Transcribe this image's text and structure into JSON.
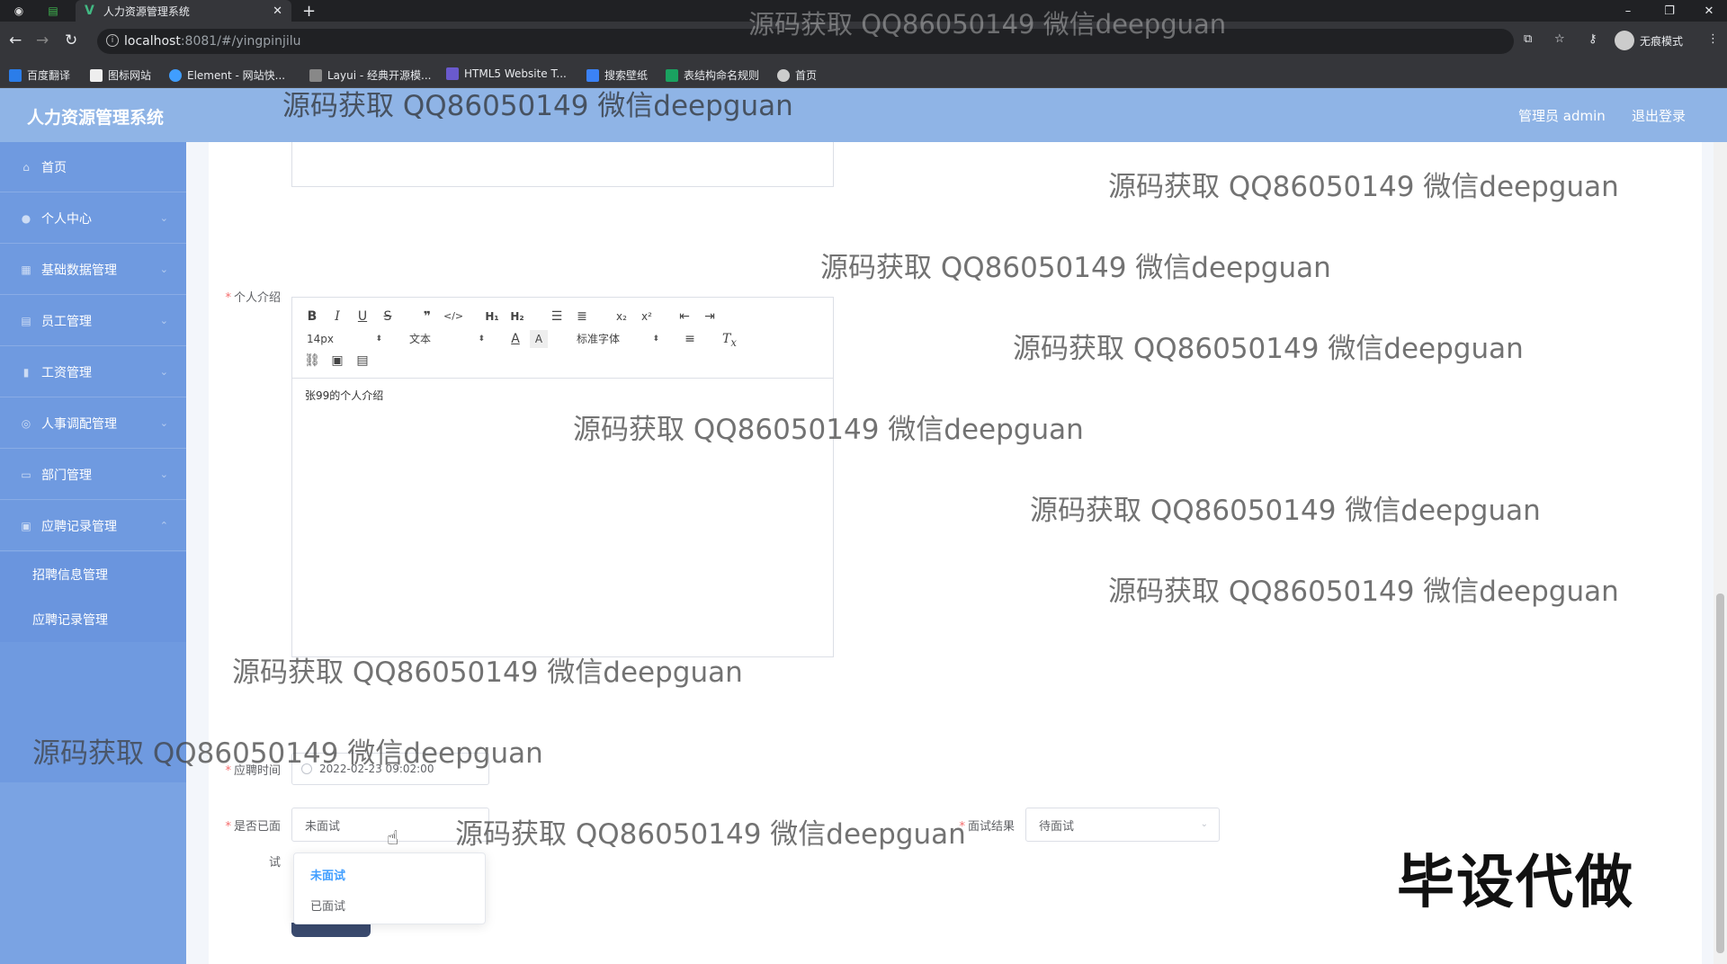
{
  "browser": {
    "tab_title": "人力资源管理系统",
    "tab_close": "✕",
    "new_tab": "+",
    "url_host": "localhost",
    "url_path": ":8081/#/yingpinjilu",
    "incognito_label": "无痕模式",
    "bookmarks": [
      "百度翻译",
      "图标网站",
      "Element - 网站快...",
      "Layui - 经典开源模...",
      "HTML5 Website T...",
      "搜索壁纸",
      "表结构命名规则",
      "首页"
    ]
  },
  "header": {
    "title": "人力资源管理系统",
    "admin_label": "管理员 admin",
    "logout": "退出登录"
  },
  "sidebar": {
    "items": [
      {
        "label": "首页"
      },
      {
        "label": "个人中心"
      },
      {
        "label": "基础数据管理"
      },
      {
        "label": "员工管理"
      },
      {
        "label": "工资管理"
      },
      {
        "label": "人事调配管理"
      },
      {
        "label": "部门管理"
      },
      {
        "label": "应聘记录管理"
      }
    ],
    "sub_items": [
      {
        "label": "招聘信息管理"
      },
      {
        "label": "应聘记录管理"
      }
    ]
  },
  "form": {
    "intro_label": "个人介绍",
    "editor": {
      "font_size": "14px",
      "text_type": "文本",
      "font_family": "标准字体",
      "content": "张99的个人介绍"
    },
    "apply_time_label": "应聘时间",
    "apply_time_value": "2022-02-23 09:02:00",
    "interviewed_label_1": "是否已面",
    "interviewed_label_2": "试",
    "interviewed_value": "未面试",
    "interview_result_label": "面试结果",
    "interview_result_value": "待面试",
    "dropdown_options": [
      "未面试",
      "已面试"
    ]
  },
  "watermarks": {
    "text": "源码获取 QQ86050149 微信deepguan",
    "corner_text": "毕设代做"
  }
}
